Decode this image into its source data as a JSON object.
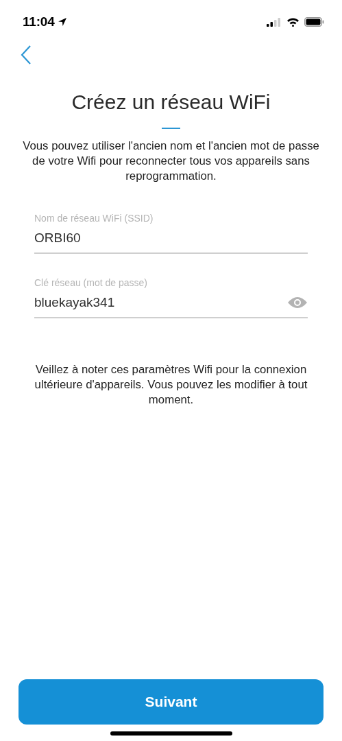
{
  "status_bar": {
    "time": "11:04"
  },
  "title": "Créez un réseau WiFi",
  "description": "Vous pouvez utiliser l'ancien nom et l'ancien mot de passe de votre Wifi pour reconnecter tous vos appareils sans reprogrammation.",
  "fields": [
    {
      "kind": "text",
      "label": "Nom de réseau WiFi (SSID)",
      "value": "ORBI60"
    },
    {
      "kind": "password",
      "label": "Clé réseau (mot de passe)",
      "value": "bluekayak341"
    }
  ],
  "note": "Veillez à noter ces paramètres Wifi pour la connexion ultérieure d'appareils. Vous pouvez les modifier à tout moment.",
  "next_button": "Suivant"
}
